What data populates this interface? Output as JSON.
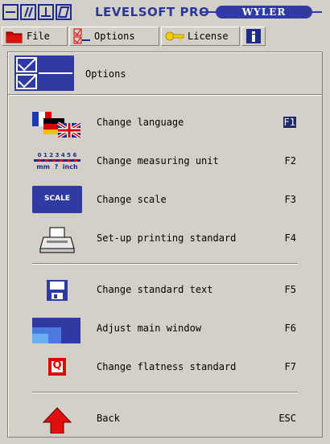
{
  "app": {
    "title": "LEVELSOFT PRO",
    "brand": "WYLER"
  },
  "menubar": [
    {
      "label": "File",
      "icon": "folder-icon"
    },
    {
      "label": "Options",
      "icon": "checklist-icon"
    },
    {
      "label": "License",
      "icon": "key-icon"
    },
    {
      "label": "",
      "icon": "info-icon"
    }
  ],
  "options": {
    "title": "Options",
    "items": [
      {
        "label": "Change language",
        "key": "F1",
        "icon": "flags-icon"
      },
      {
        "label": "Change measuring unit",
        "key": "F2",
        "icon": "unit-ruler-icon",
        "icon_text_top": "0 1 2 3 4 5 6",
        "icon_text_bottom": "mm  ?  inch"
      },
      {
        "label": "Change scale",
        "key": "F3",
        "icon": "scale-icon",
        "icon_text": "SCALE"
      },
      {
        "label": "Set-up printing standard",
        "key": "F4",
        "icon": "printer-icon"
      },
      {
        "label": "Change standard text",
        "key": "F5",
        "icon": "floppy-disk-icon"
      },
      {
        "label": "Adjust main window",
        "key": "F6",
        "icon": "window-icon"
      },
      {
        "label": "Change flatness standard",
        "key": "F7",
        "icon": "flatness-q-icon",
        "icon_text": "Q"
      },
      {
        "label": "Back",
        "key": "ESC",
        "icon": "red-up-arrow-icon"
      }
    ]
  },
  "colors": {
    "accent": "#2f3aa2",
    "background": "#d4d0c8",
    "selected_key_bg": "#1c2a6c"
  }
}
